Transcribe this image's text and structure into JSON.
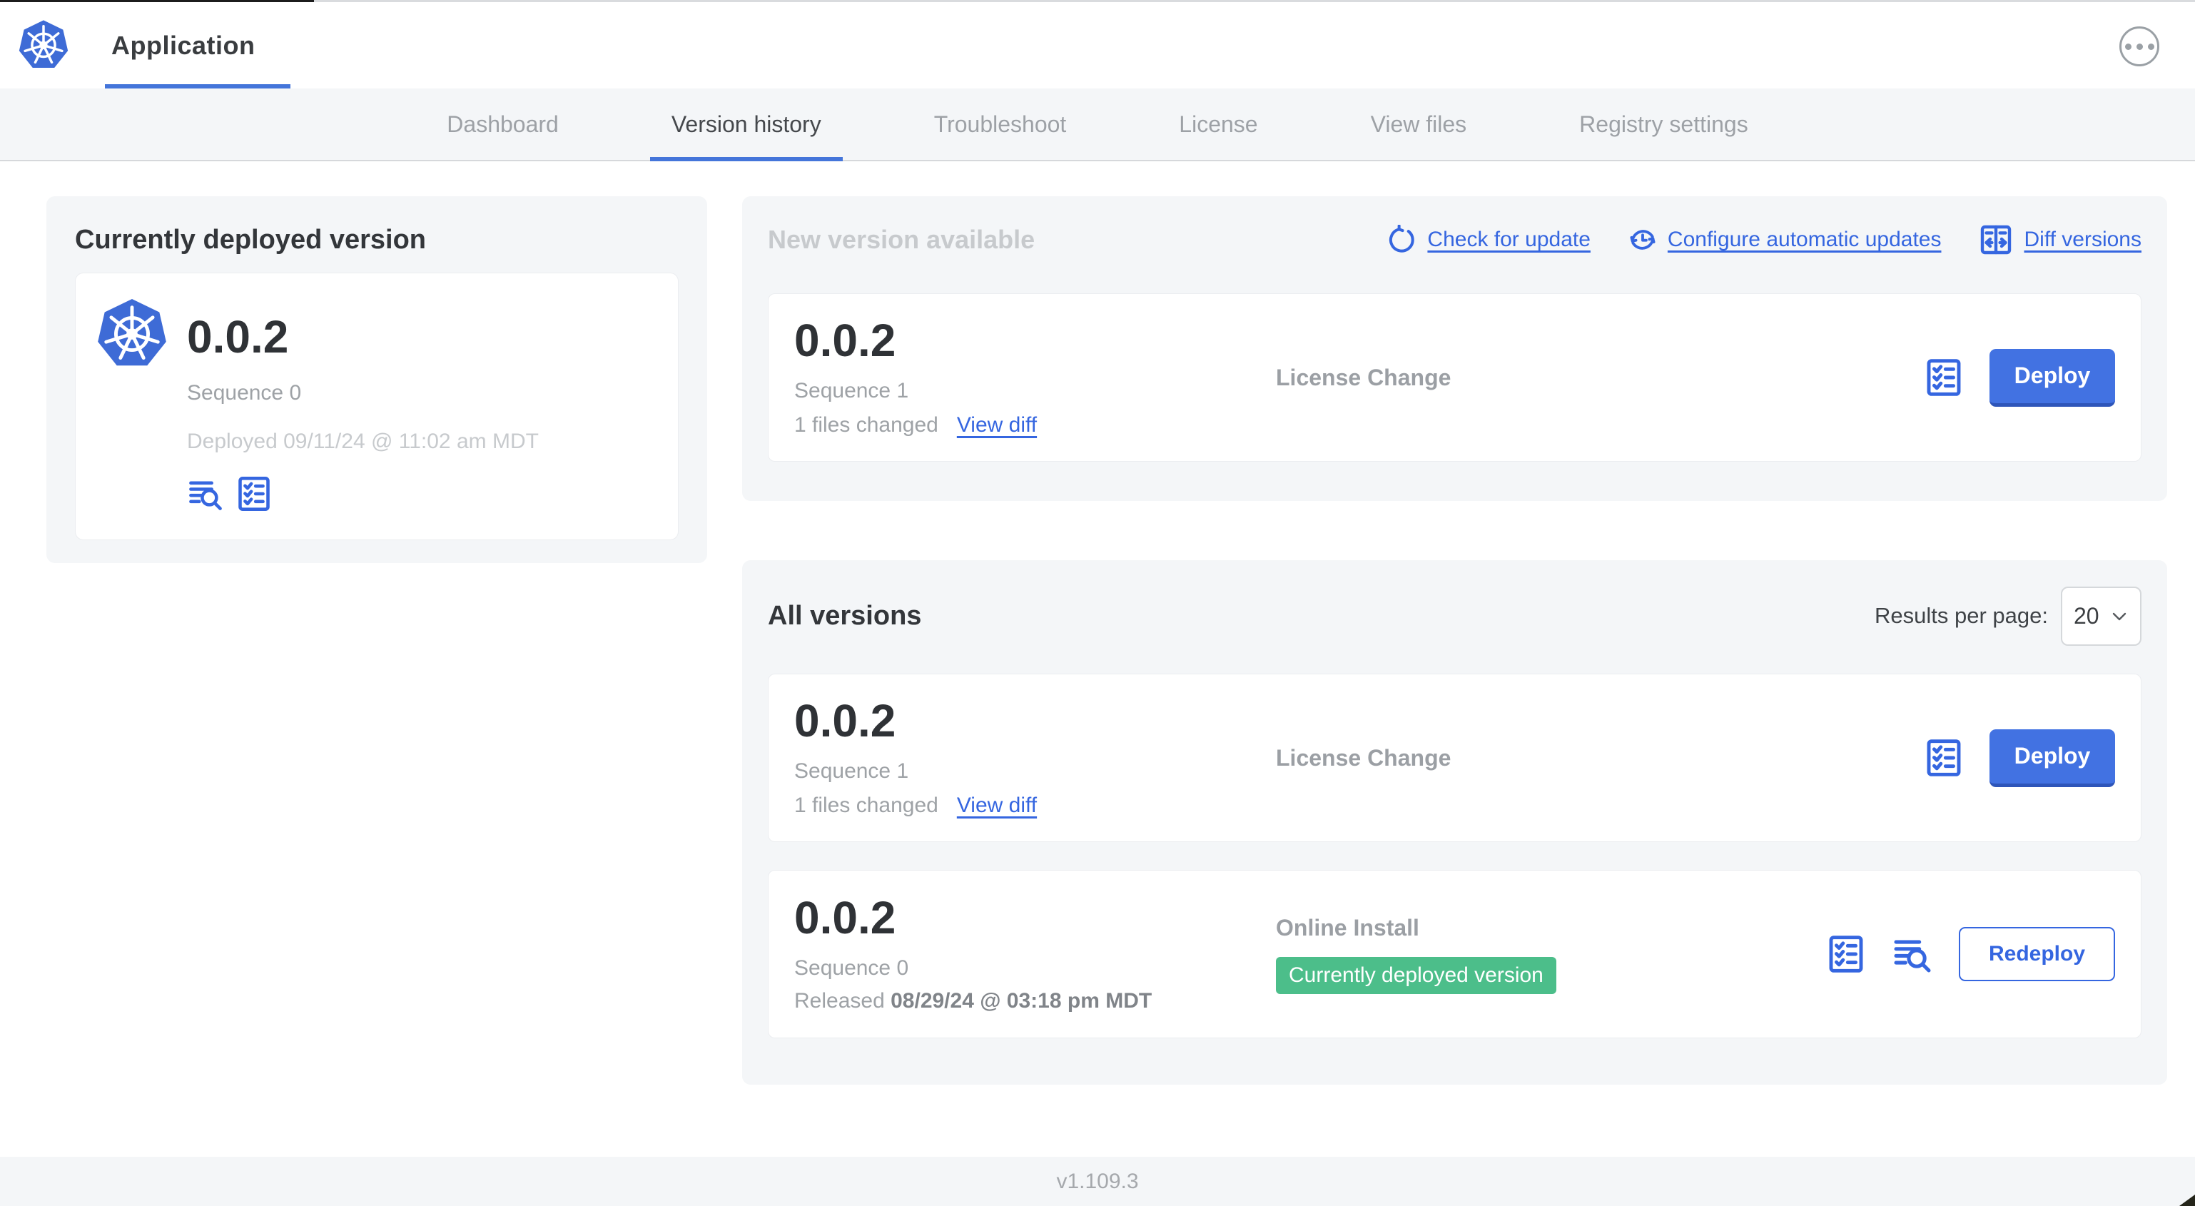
{
  "app": {
    "title": "Application"
  },
  "tabs": {
    "dashboard": "Dashboard",
    "version_history": "Version history",
    "troubleshoot": "Troubleshoot",
    "license": "License",
    "view_files": "View files",
    "registry_settings": "Registry settings"
  },
  "current": {
    "heading": "Currently deployed version",
    "version": "0.0.2",
    "sequence": "Sequence 0",
    "deployed": "Deployed 09/11/24 @ 11:02 am MDT"
  },
  "new_version": {
    "title": "New version available",
    "check_link": "Check for update",
    "configure_link": "Configure automatic updates",
    "diff_link": "Diff versions",
    "row": {
      "version": "0.0.2",
      "sequence": "Sequence 1",
      "files_changed": "1 files changed",
      "view_diff": "View diff",
      "source": "License Change",
      "action": "Deploy"
    }
  },
  "all_versions": {
    "title": "All versions",
    "results_label": "Results per page:",
    "results_value": "20",
    "rows": [
      {
        "version": "0.0.2",
        "sequence": "Sequence 1",
        "files_changed": "1 files changed",
        "view_diff": "View diff",
        "source": "License Change",
        "action": "Deploy"
      },
      {
        "version": "0.0.2",
        "sequence": "Sequence 0",
        "released_prefix": "Released",
        "released_date": "08/29/24 @ 03:18 pm MDT",
        "source": "Online Install",
        "badge": "Currently deployed version",
        "action": "Redeploy"
      }
    ]
  },
  "footer": {
    "version": "v1.109.3"
  },
  "colors": {
    "accent_blue": "#3566e0",
    "button_blue": "#4272e2",
    "active_underline": "#4475da",
    "badge_green": "#4cbe8a",
    "panel_gray": "#f4f6f8"
  }
}
